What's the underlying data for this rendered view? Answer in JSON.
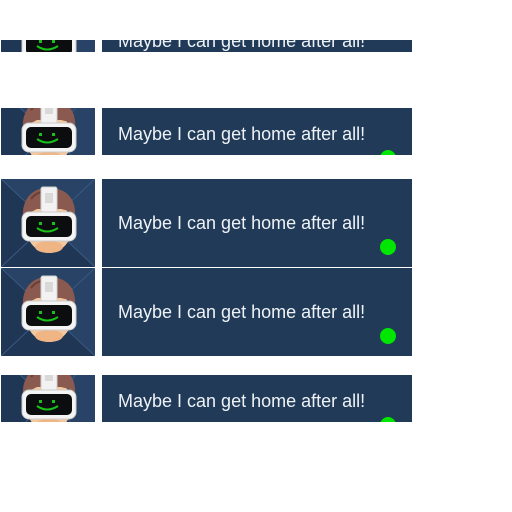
{
  "dialogues": [
    {
      "text": "Maybe I can get home after all!",
      "status_color": "#00e600"
    },
    {
      "text": "Maybe I can get home after all!",
      "status_color": "#00e600"
    },
    {
      "text": "Maybe I can get home after all!",
      "status_color": "#00e600"
    },
    {
      "text": "Maybe I can get home after all!",
      "status_color": "#00e600"
    },
    {
      "text": "Maybe I can get home after all!",
      "status_color": "#00e600"
    }
  ],
  "portrait_icon": "robot-visor-character-icon",
  "colors": {
    "panel": "#203a58",
    "portrait_bg": "#233a5a",
    "status_online": "#00e600",
    "visor_smile": "#18c018"
  }
}
